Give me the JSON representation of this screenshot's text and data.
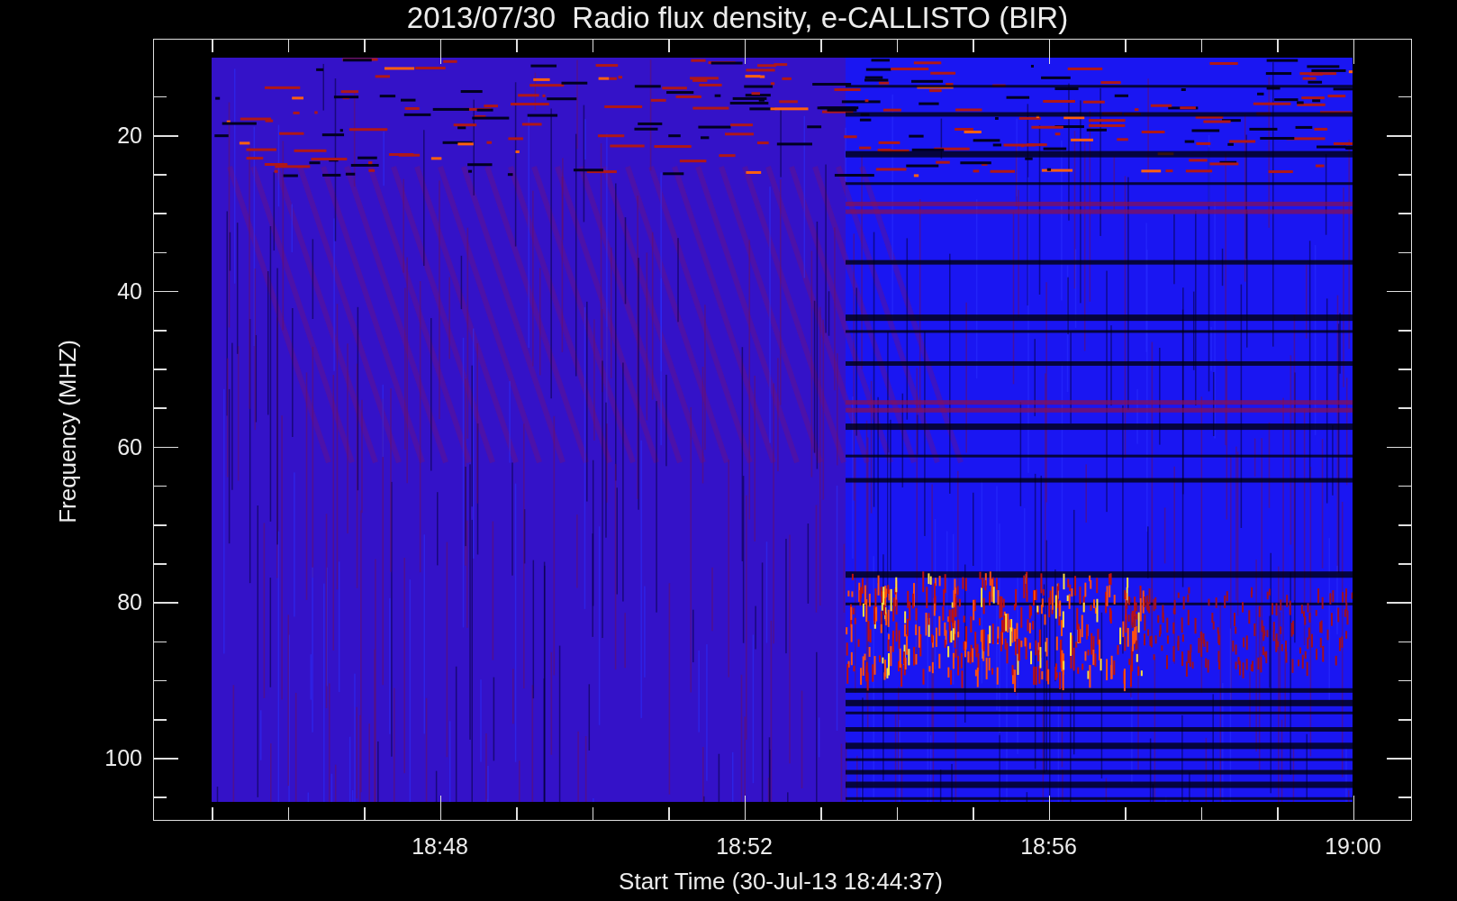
{
  "title": "2013/07/30  Radio flux density, e-CALLISTO (BIR)",
  "chart": {
    "ylabel": "Frequency (MHZ)",
    "xlabel": "Start Time (30-Jul-13 18:44:37)",
    "yticks": [
      "20",
      "40",
      "60",
      "80",
      "100"
    ],
    "xticks": [
      "18:48",
      "18:52",
      "18:56",
      "19:00"
    ]
  }
}
